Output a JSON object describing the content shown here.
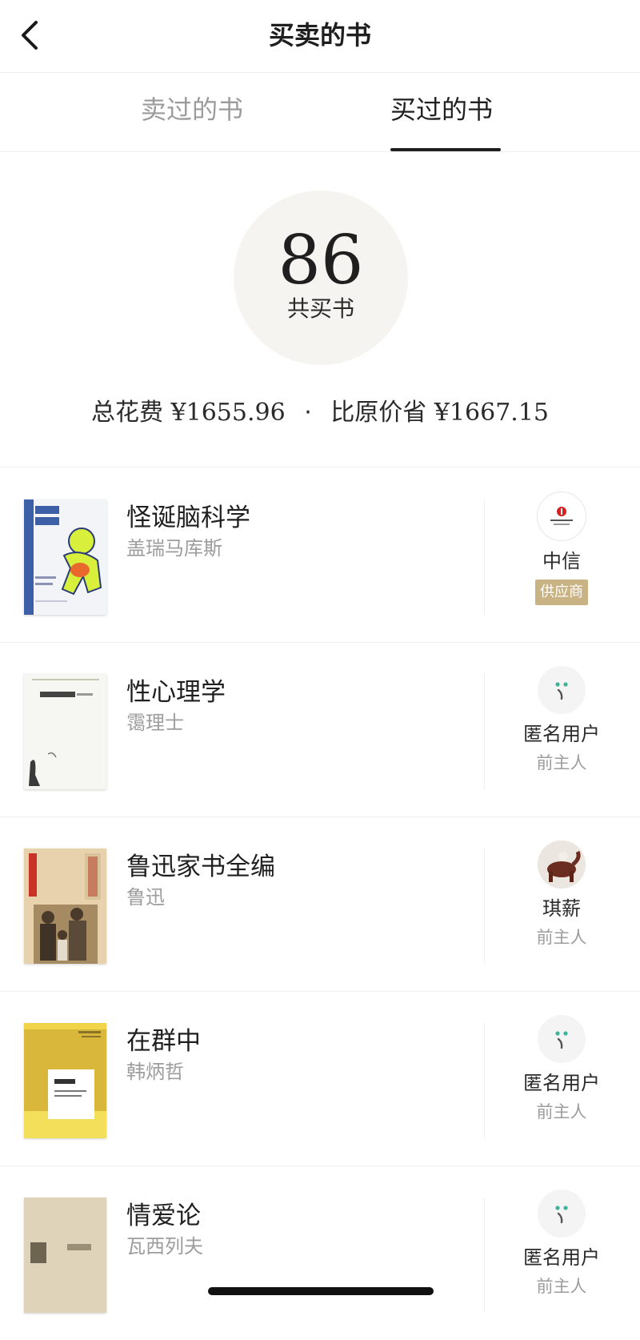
{
  "header": {
    "title": "买卖的书",
    "back_icon": "chevron-left-icon"
  },
  "tabs": [
    {
      "label": "卖过的书",
      "active": false
    },
    {
      "label": "买过的书",
      "active": true
    }
  ],
  "stats": {
    "count": "86",
    "count_label": "共买书",
    "spent_label": "总花费",
    "spent_value": "¥1655.96",
    "separator": "·",
    "saved_label": "比原价省",
    "saved_value": "¥1667.15"
  },
  "books": [
    {
      "title": "怪诞脑科学",
      "author": "盖瑞马库斯",
      "seller": {
        "name": "中信",
        "role": "供应商",
        "role_style": "badge",
        "avatar": "citic-logo-icon"
      }
    },
    {
      "title": "性心理学",
      "author": "霭理士",
      "seller": {
        "name": "匿名用户",
        "role": "前主人",
        "role_style": "text",
        "avatar": "anonymous-user-icon"
      }
    },
    {
      "title": "鲁迅家书全编",
      "author": "鲁迅",
      "seller": {
        "name": "琪薪",
        "role": "前主人",
        "role_style": "text",
        "avatar": "user-avatar-photo"
      }
    },
    {
      "title": "在群中",
      "author": "韩炳哲",
      "seller": {
        "name": "匿名用户",
        "role": "前主人",
        "role_style": "text",
        "avatar": "anonymous-user-icon"
      }
    },
    {
      "title": "情爱论",
      "author": "瓦西列夫",
      "seller": {
        "name": "匿名用户",
        "role": "前主人",
        "role_style": "text",
        "avatar": "anonymous-user-icon"
      }
    }
  ],
  "colors": {
    "badge": "#c9b284",
    "muted_text": "#9d9d9d",
    "stat_circle": "#f6f4f0"
  }
}
